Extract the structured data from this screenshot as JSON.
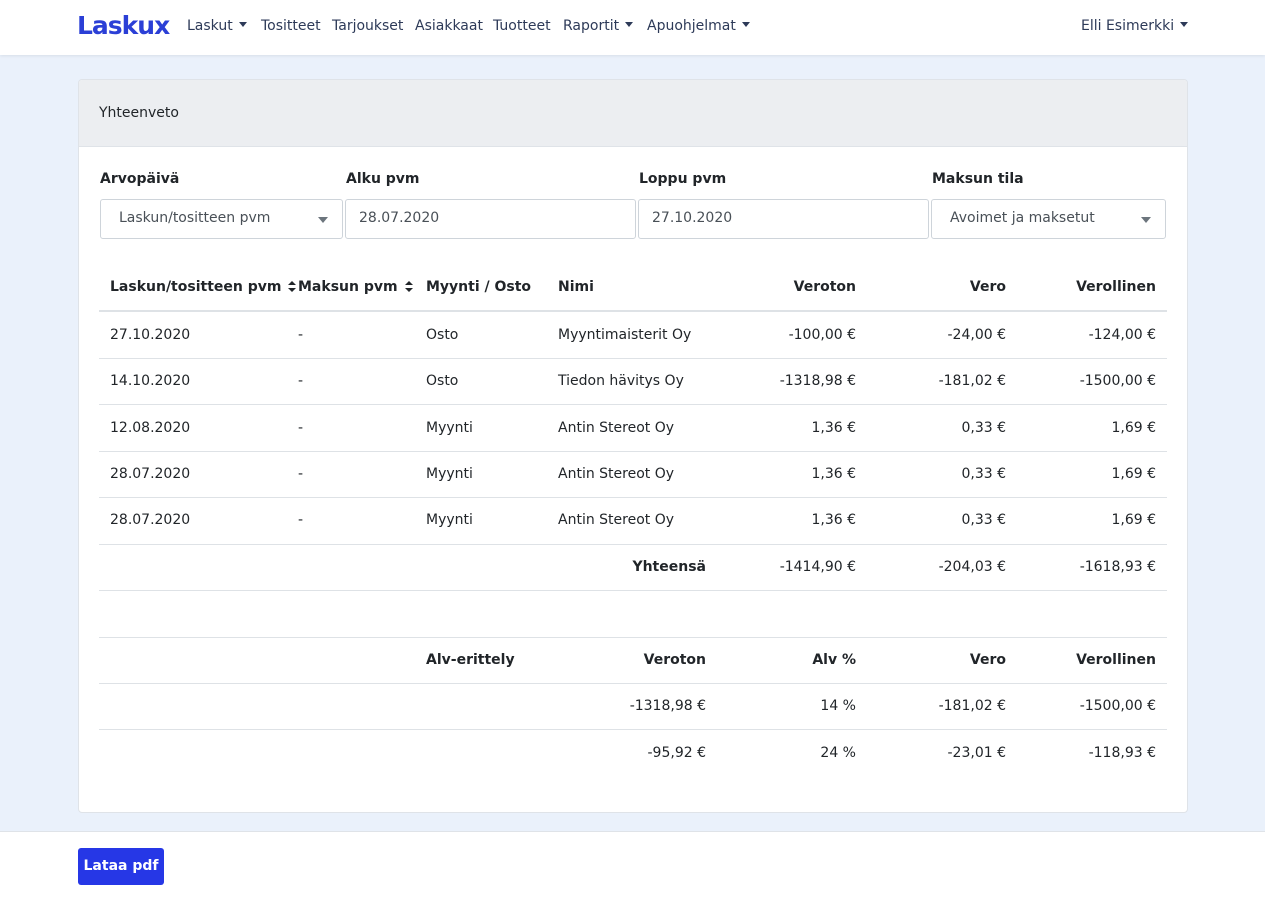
{
  "brand": {
    "logo_text": "Laskux",
    "accent": "#2b3fd6"
  },
  "nav": {
    "items": [
      {
        "label": "Laskut",
        "dropdown": true
      },
      {
        "label": "Tositteet",
        "dropdown": false
      },
      {
        "label": "Tarjoukset",
        "dropdown": false
      },
      {
        "label": "Asiakkaat",
        "dropdown": false
      },
      {
        "label": "Tuotteet",
        "dropdown": false
      },
      {
        "label": "Raportit",
        "dropdown": true
      },
      {
        "label": "Apuohjelmat",
        "dropdown": true
      }
    ],
    "user": "Elli Esimerkki"
  },
  "card": {
    "title": "Yhteenveto"
  },
  "filters": {
    "arvopaiva": {
      "label": "Arvopäivä",
      "value": "Laskun/tositteen pvm"
    },
    "alku": {
      "label": "Alku pvm",
      "value": "28.07.2020"
    },
    "loppu": {
      "label": "Loppu pvm",
      "value": "27.10.2020"
    },
    "maksun_tila": {
      "label": "Maksun tila",
      "value": "Avoimet ja maksetut"
    }
  },
  "table": {
    "headers": {
      "date": "Laskun/tositteen pvm",
      "paid": "Maksun pvm",
      "type": "Myynti / Osto",
      "name": "Nimi",
      "net": "Veroton",
      "tax": "Vero",
      "gross": "Verollinen"
    },
    "rows": [
      {
        "date": "27.10.2020",
        "paid": "-",
        "type": "Osto",
        "name": "Myyntimaisterit Oy",
        "net": "-100,00 €",
        "tax": "-24,00 €",
        "gross": "-124,00 €"
      },
      {
        "date": "14.10.2020",
        "paid": "-",
        "type": "Osto",
        "name": "Tiedon hävitys Oy",
        "net": "-1318,98 €",
        "tax": "-181,02 €",
        "gross": "-1500,00 €"
      },
      {
        "date": "12.08.2020",
        "paid": "-",
        "type": "Myynti",
        "name": "Antin Stereot Oy",
        "net": "1,36 €",
        "tax": "0,33 €",
        "gross": "1,69 €"
      },
      {
        "date": "28.07.2020",
        "paid": "-",
        "type": "Myynti",
        "name": "Antin Stereot Oy",
        "net": "1,36 €",
        "tax": "0,33 €",
        "gross": "1,69 €"
      },
      {
        "date": "28.07.2020",
        "paid": "-",
        "type": "Myynti",
        "name": "Antin Stereot Oy",
        "net": "1,36 €",
        "tax": "0,33 €",
        "gross": "1,69 €"
      }
    ],
    "total": {
      "label": "Yhteensä",
      "net": "-1414,90 €",
      "tax": "-204,03 €",
      "gross": "-1618,93 €"
    }
  },
  "vat": {
    "headers": {
      "title": "Alv-erittely",
      "net": "Veroton",
      "rate": "Alv %",
      "tax": "Vero",
      "gross": "Verollinen"
    },
    "rows": [
      {
        "net": "-1318,98 €",
        "rate": "14 %",
        "tax": "-181,02 €",
        "gross": "-1500,00 €"
      },
      {
        "net": "-95,92 €",
        "rate": "24 %",
        "tax": "-23,01 €",
        "gross": "-118,93 €"
      }
    ]
  },
  "footer": {
    "pdf_button": "Lataa pdf"
  }
}
